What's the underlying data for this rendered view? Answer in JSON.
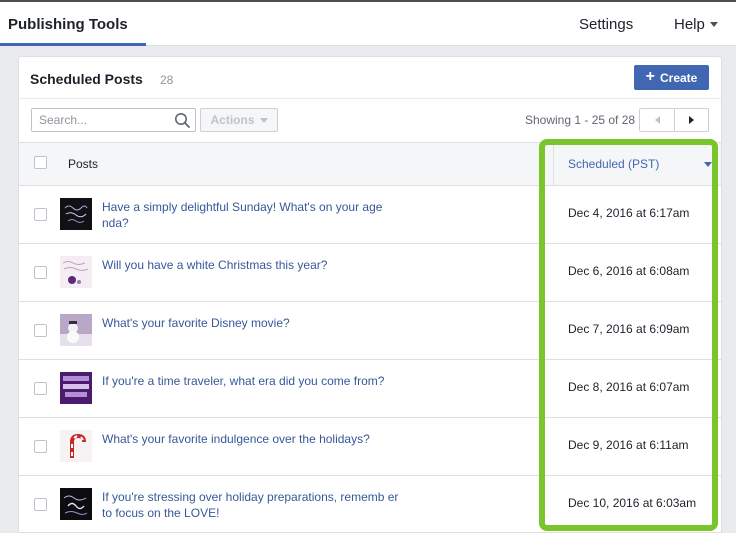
{
  "topbar": {
    "title": "Publishing Tools",
    "settings": "Settings",
    "help": "Help"
  },
  "panel": {
    "title": "Scheduled Posts",
    "count": "28",
    "create_label": "Create"
  },
  "toolbar": {
    "search_placeholder": "Search...",
    "actions_label": "Actions",
    "showing": "Showing 1 - 25 of 28"
  },
  "table": {
    "col_posts": "Posts",
    "col_scheduled": "Scheduled (PST)"
  },
  "rows": [
    {
      "text": "Have a simply delightful Sunday! What's on your age nda?",
      "date": "Dec 4, 2016 at 6:17am",
      "thumb": "dark-purple-script"
    },
    {
      "text": "Will you have a white Christmas this year?",
      "date": "Dec 6, 2016 at 6:08am",
      "thumb": "white-ornament"
    },
    {
      "text": "What's your favorite Disney movie?",
      "date": "Dec 7, 2016 at 6:09am",
      "thumb": "snowman"
    },
    {
      "text": "If you're a time traveler, what era did you come from?",
      "date": "Dec 8, 2016 at 6:07am",
      "thumb": "purple-text"
    },
    {
      "text": "What's your favorite indulgence over the holidays?",
      "date": "Dec 9, 2016 at 6:11am",
      "thumb": "candy-cane"
    },
    {
      "text": "If you're stressing over holiday preparations, rememb er to focus on the LOVE!",
      "date": "Dec 10, 2016 at 6:03am",
      "thumb": "dark-love-script"
    }
  ],
  "colors": {
    "accent": "#4267b2",
    "link": "#365899",
    "highlight": "#7ac52b"
  }
}
